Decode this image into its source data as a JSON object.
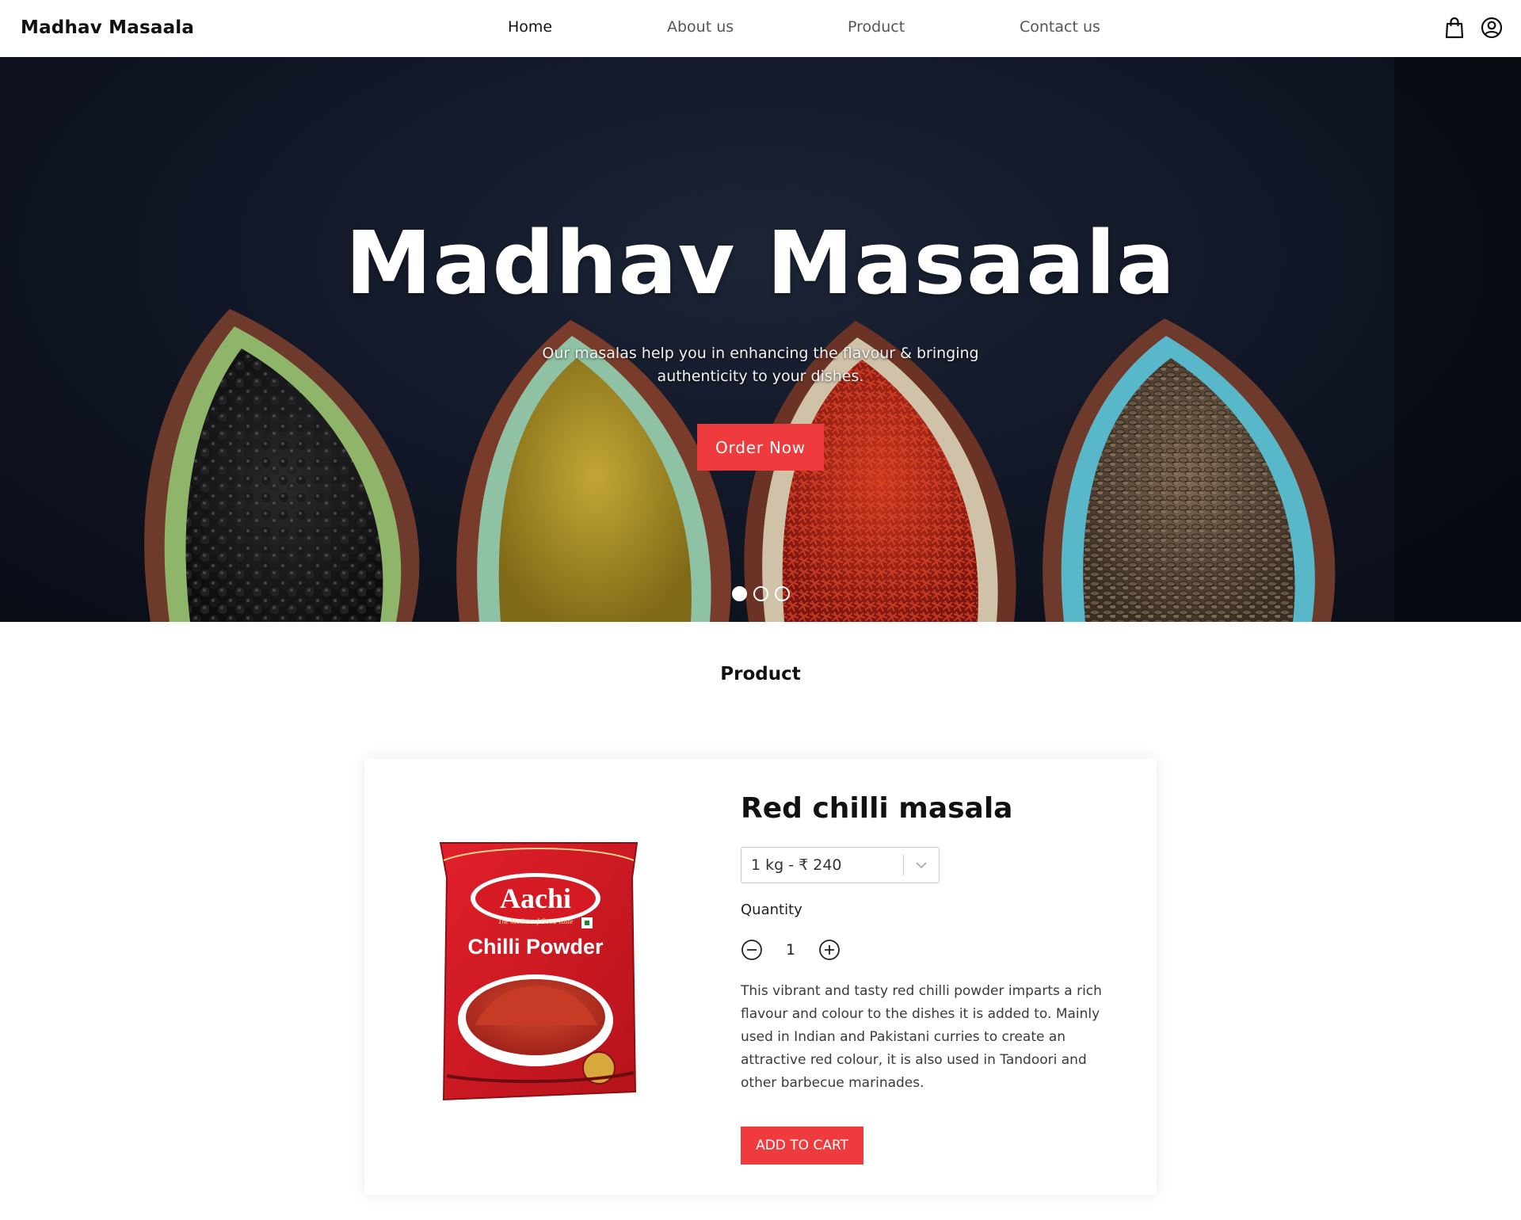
{
  "header": {
    "brand": "Madhav Masaala",
    "nav": [
      {
        "label": "Home",
        "active": true
      },
      {
        "label": "About us",
        "active": false
      },
      {
        "label": "Product",
        "active": false
      },
      {
        "label": "Contact us",
        "active": false
      }
    ],
    "icons": [
      "shopping-bag-icon",
      "user-account-icon"
    ]
  },
  "hero": {
    "title": "Madhav Masaala",
    "subtitle": "Our masalas help you in enhancing the flavour & bringing authenticity to your dishes.",
    "cta_label": "Order Now",
    "slides": {
      "count": 3,
      "active_index": 0
    }
  },
  "product_section": {
    "title": "Product"
  },
  "product": {
    "packet": {
      "brand": "Aachi",
      "tagline": "The Mother of Good Taste",
      "name": "Chilli Powder"
    },
    "name": "Red chilli masala",
    "size_selected": "1 kg - ₹ 240",
    "quantity_label": "Quantity",
    "quantity": "1",
    "description": "This vibrant and tasty red chilli powder imparts a rich flavour and colour to the dishes it is added to. Mainly used in Indian and Pakistani curries to create an attractive red colour, it is also used in Tandoori and other barbecue marinades.",
    "add_to_cart_label": "ADD TO CART"
  },
  "colors": {
    "accent": "#ef3b3d",
    "hero_background": "#111726"
  }
}
